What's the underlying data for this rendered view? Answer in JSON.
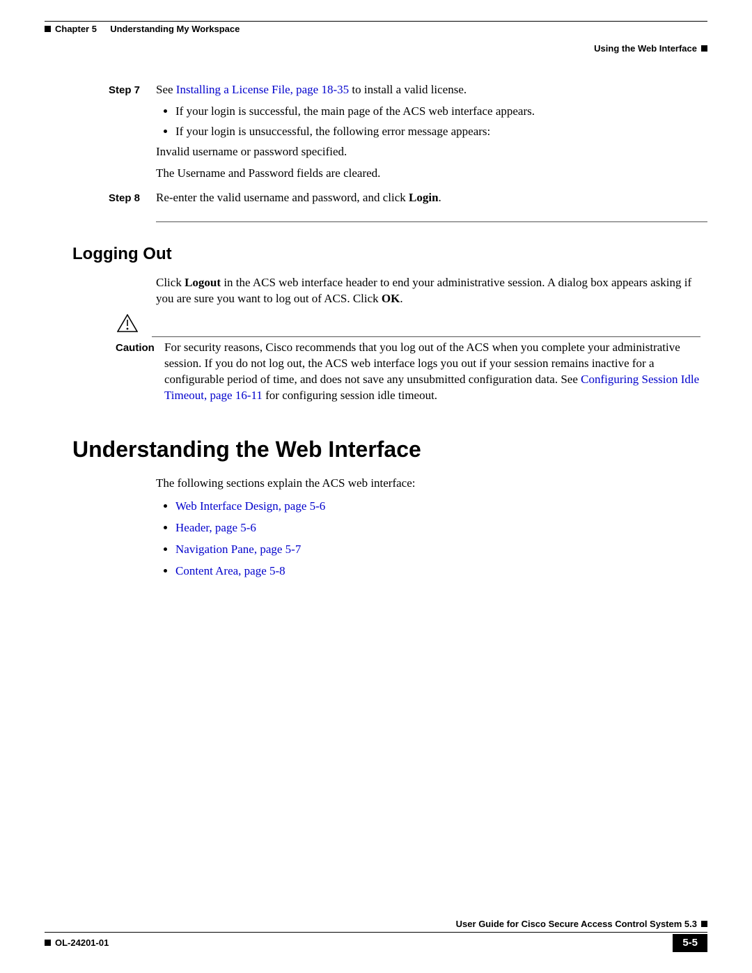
{
  "header": {
    "chapter_label": "Chapter 5",
    "chapter_title": "Understanding My Workspace",
    "section_title": "Using the Web Interface"
  },
  "step7": {
    "label": "Step 7",
    "text_before_link": "See ",
    "link": "Installing a License File, page 18-35",
    "text_after_link": " to install a valid license.",
    "bullets": [
      "If your login is successful, the main page of the ACS web interface appears.",
      "If your login is unsuccessful, the following error message appears:"
    ],
    "indent1": "Invalid username or password specified.",
    "indent2": "The Username and Password fields are cleared."
  },
  "step8": {
    "label": "Step 8",
    "text_before": "Re-enter the valid username and password, and click ",
    "bold": "Login",
    "text_after": "."
  },
  "logging_out": {
    "heading": "Logging Out",
    "para_parts": {
      "t1": "Click ",
      "b1": "Logout",
      "t2": " in the ACS web interface header to end your administrative session. A dialog box appears asking if you are sure you want to log out of ACS. Click ",
      "b2": "OK",
      "t3": "."
    }
  },
  "caution": {
    "label": "Caution",
    "text_before_link": "For security reasons, Cisco recommends that you log out of the ACS when you complete your administrative session. If you do not log out, the ACS web interface logs you out if your session remains inactive for a configurable period of time, and does not save any unsubmitted configuration data. See ",
    "link": "Configuring Session Idle Timeout, page 16-11",
    "text_after_link": " for configuring session idle timeout."
  },
  "understanding": {
    "heading": "Understanding the Web Interface",
    "intro": "The following sections explain the ACS web interface:",
    "links": [
      "Web Interface Design, page 5-6",
      "Header, page 5-6",
      "Navigation Pane, page 5-7",
      "Content Area, page 5-8"
    ]
  },
  "footer": {
    "guide": "User Guide for Cisco Secure Access Control System 5.3",
    "doc_id": "OL-24201-01",
    "page": "5-5"
  }
}
